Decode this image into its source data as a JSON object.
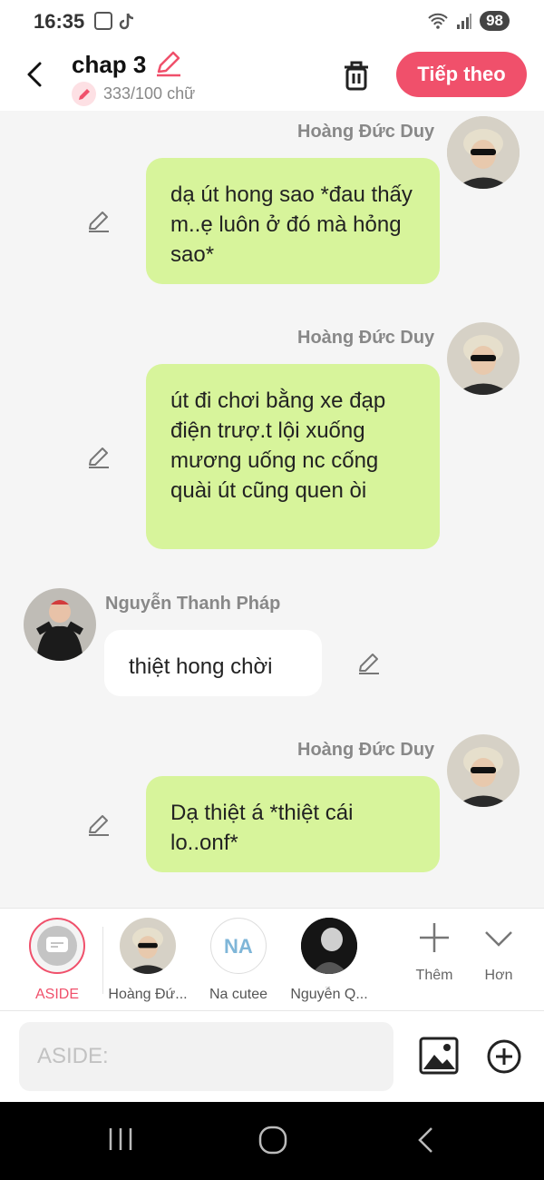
{
  "status_bar": {
    "time": "16:35",
    "battery": "98"
  },
  "header": {
    "title": "chap 3",
    "word_count": "333/100 chữ",
    "next_button": "Tiếp theo"
  },
  "messages": [
    {
      "side": "right",
      "sender": "Hoàng Đức Duy",
      "text": "dạ út hong sao *đau thấy m..ẹ luôn ở đó mà hỏng sao*"
    },
    {
      "side": "right",
      "sender": "Hoàng Đức Duy",
      "text": "út đi chơi bằng xe đạp điện trượ.t lội xuống mương uống nc cống quài út cũng quen òi"
    },
    {
      "side": "left",
      "sender": "Nguyễn Thanh Pháp",
      "text": "thiệt hong chời"
    },
    {
      "side": "right",
      "sender": "Hoàng Đức Duy",
      "text": "Dạ thiệt á *thiệt cái lo..onf*"
    }
  ],
  "characters": [
    {
      "label": "ASIDE"
    },
    {
      "label": "Hoàng Đứ..."
    },
    {
      "label": "Na cutee"
    },
    {
      "label": "Nguyễn Q..."
    }
  ],
  "tools": {
    "add_label": "Thêm",
    "more_label": "Hơn"
  },
  "composer": {
    "placeholder": "ASIDE:"
  },
  "colors": {
    "accent": "#f0506b",
    "bubble_right": "#d7f49b",
    "bubble_left": "#ffffff"
  }
}
